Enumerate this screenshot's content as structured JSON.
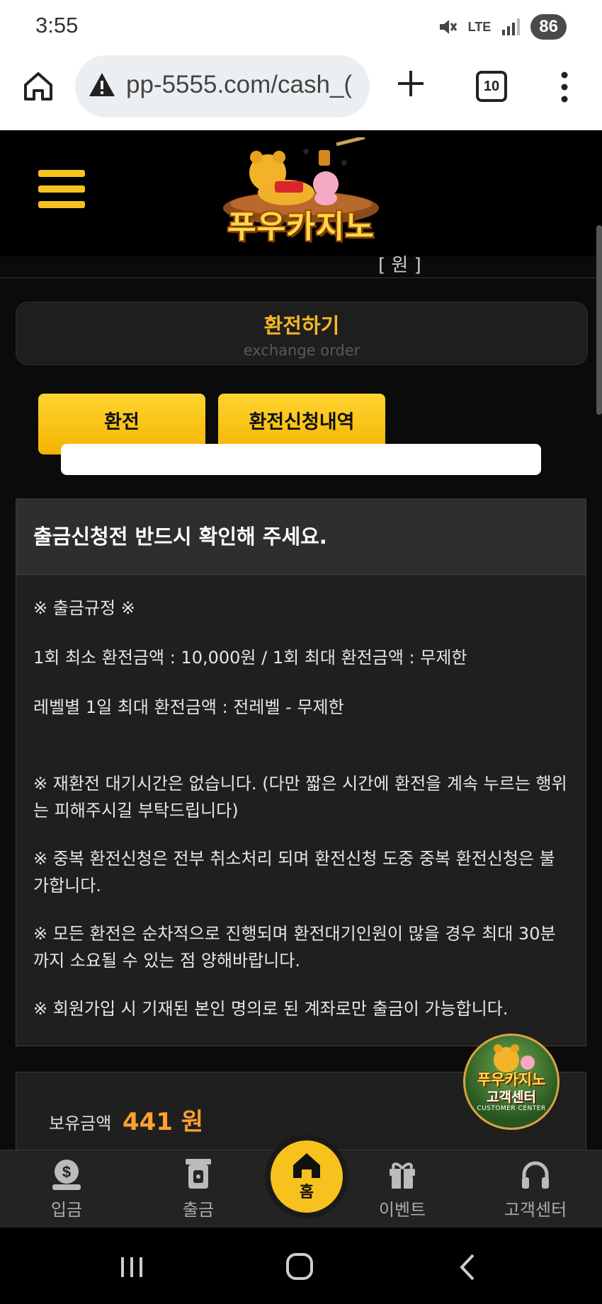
{
  "status_bar": {
    "time": "3:55",
    "network": "LTE",
    "battery": "86"
  },
  "browser": {
    "url": "pp-5555.com/cash_(",
    "tab_count": "10"
  },
  "site": {
    "logo_text": "푸우카지노",
    "header_strip_tail": "[ 원 ]"
  },
  "page_title": {
    "korean": "환전하기",
    "english": "exchange order"
  },
  "tabs": [
    {
      "label": "환전"
    },
    {
      "label": "환전신청내역"
    }
  ],
  "notice": {
    "heading": "출금신청전 반드시 확인해 주세요.",
    "rule_title": "※ 출금규정 ※",
    "min_max": "1회 최소 환전금액 : 10,000원 / 1회 최대 환전금액 : 무제한",
    "daily_max": "레벨별 1일 최대 환전금액 : 전레벨 - 무제한",
    "note_wait": "※ 재환전 대기시간은 없습니다. (다만 짧은 시간에 환전을 계속 누르는 행위는 피해주시길 부탁드립니다)",
    "note_duplicate": "※ 중복 환전신청은 전부 취소처리 되며 환전신청 도중 중복 환전신청은 불가합니다.",
    "note_order": "※ 모든 환전은 순차적으로 진행되며 환전대기인원이 많을 경우 최대 30분까지 소요될 수 있는 점 양해바랍니다.",
    "note_account": "※ 회원가입 시 기재된 본인 명의로 된 계좌로만 출금이 가능합니다."
  },
  "balance": {
    "label": "보유금액",
    "amount": "441 원"
  },
  "customer_badge": {
    "title": "푸우카지노",
    "subtitle": "고객센터",
    "caption": "CUSTOMER CENTER"
  },
  "bottom_nav": {
    "deposit": "입금",
    "withdraw": "출금",
    "home": "홈",
    "event": "이벤트",
    "support": "고객센터"
  },
  "colors": {
    "accent": "#f7c21e",
    "title_orange": "#f7b625",
    "balance_orange": "#ff9f2e",
    "panel": "#1f1f1f"
  }
}
